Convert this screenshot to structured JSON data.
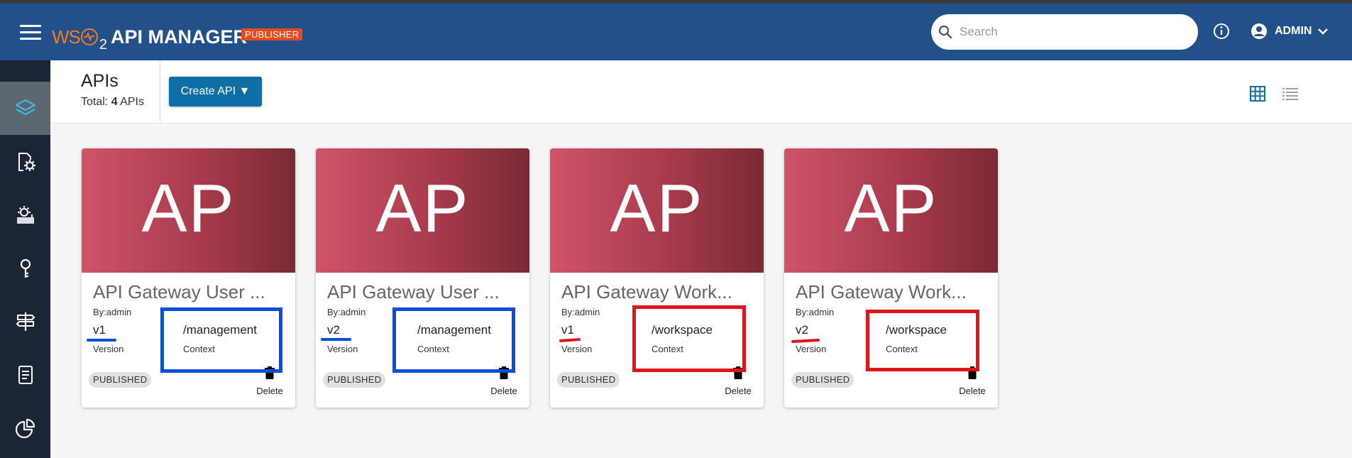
{
  "header": {
    "logo_wso": "WS",
    "logo_two": "2",
    "app_title": "API MANAGER",
    "publisher_badge": "PUBLISHER",
    "search_placeholder": "Search",
    "user_label": "ADMIN"
  },
  "sidebar": {
    "items": [
      "apis-icon",
      "api-settings-icon",
      "service-catalog-icon",
      "keys-icon",
      "signpost-icon",
      "document-icon",
      "analytics-icon"
    ],
    "active_index": 0
  },
  "subheader": {
    "title": "APIs",
    "total_prefix": "Total:",
    "total_count": "4",
    "total_suffix": "APIs",
    "create_button": "Create API ▼"
  },
  "cards": [
    {
      "thumb": "AP",
      "title": "API Gateway User ...",
      "by": "By:admin",
      "version": "v1",
      "version_label": "Version",
      "context": "/management",
      "context_label": "Context",
      "status": "PUBLISHED",
      "delete_label": "Delete"
    },
    {
      "thumb": "AP",
      "title": "API Gateway User ...",
      "by": "By:admin",
      "version": "v2",
      "version_label": "Version",
      "context": "/management",
      "context_label": "Context",
      "status": "PUBLISHED",
      "delete_label": "Delete"
    },
    {
      "thumb": "AP",
      "title": "API Gateway Work...",
      "by": "By:admin",
      "version": "v1",
      "version_label": "Version",
      "context": "/workspace",
      "context_label": "Context",
      "status": "PUBLISHED",
      "delete_label": "Delete"
    },
    {
      "thumb": "AP",
      "title": "API Gateway Work...",
      "by": "By:admin",
      "version": "v2",
      "version_label": "Version",
      "context": "/workspace",
      "context_label": "Context",
      "status": "PUBLISHED",
      "delete_label": "Delete"
    }
  ],
  "colors": {
    "header": "#21508a",
    "sidebar": "#1a2535",
    "accent_button": "#0e6fa7",
    "annotation_blue": "#0a4fd6",
    "annotation_red": "#e0151b"
  }
}
